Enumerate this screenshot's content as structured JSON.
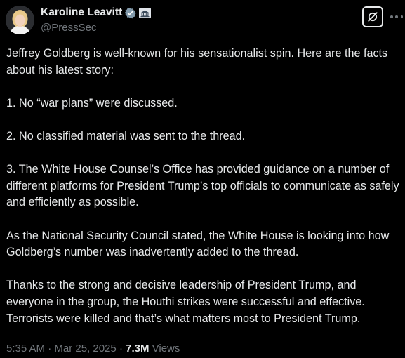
{
  "author": {
    "display_name": "Karoline Leavitt",
    "handle": "@PressSec",
    "verified_badge": "verified-check-icon",
    "affiliation_badge": "white-house-icon",
    "avatar": "avatar"
  },
  "actions": {
    "grok_icon": "grok-icon",
    "more_icon": "more-options-icon"
  },
  "tweet": {
    "paragraphs": [
      "Jeffrey Goldberg is well-known for his sensationalist spin. Here are the facts about his latest story:",
      "1. No “war plans” were discussed.",
      "2. No classified material was sent to the thread.",
      "3. The White House Counsel’s Office has provided guidance on a number of different platforms for President Trump’s top officials to communicate as safely and efficiently as possible.",
      "As the National Security Council stated, the White House is looking into how Goldberg’s number was inadvertently added to the thread.",
      "Thanks to the strong and decisive leadership of President Trump, and everyone in the group, the Houthi strikes were successful and effective. Terrorists were killed and that’s what matters most to President Trump."
    ]
  },
  "meta": {
    "time": "5:35 AM",
    "separator": " · ",
    "date": "Mar 25, 2025",
    "views_count": "7.3M",
    "views_label": " Views"
  },
  "colors": {
    "background": "#000000",
    "text_primary": "#e7e9ea",
    "text_secondary": "#71767b",
    "verified_blue": "#1d9bf0"
  }
}
